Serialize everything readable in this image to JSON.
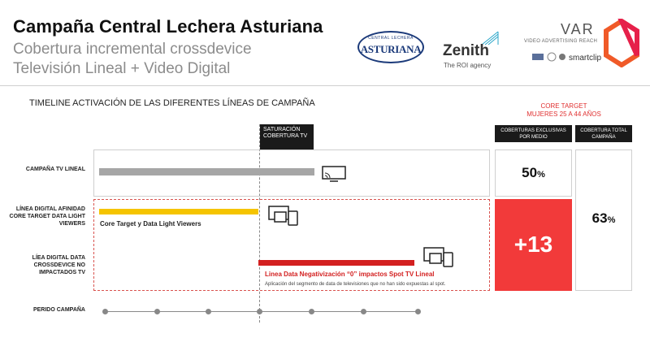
{
  "header": {
    "title": "Campaña Central Lechera Asturiana",
    "subtitle_line1": "Cobertura incremental crossdevice",
    "subtitle_line2": "Televisión Lineal + Video Digital"
  },
  "logos": {
    "asturiana_small": "CENTRAL LECHERA",
    "asturiana_big": "ASTURIANA",
    "zenith_name": "Zenith",
    "zenith_tagline": "The ROI agency",
    "var_name": "VAR",
    "var_tagline": "VIDEO ADVERTISING REACH",
    "var_partner": "smartclip"
  },
  "section": {
    "timeline_title": "TIMELINE ACTIVACIÓN DE LAS DIFERENTES  LÍNEAS DE CAMPAÑA",
    "core_target": "CORE TARGET",
    "core_target_desc": "MUJERES 25 A 44 AÑOS",
    "saturation_label": "SATURACIÓN COBERTURA TV",
    "col_exclusive": "COBERTURAS EXCLUSIVAS POR MEDIO",
    "col_total": "COBERTURA TOTAL CAMPAÑA"
  },
  "rows": {
    "tv_lineal": "CAMPAÑA TV LINEAL",
    "linea_digital": "LÍNEA DIGITAL AFINIDAD CORE TARGET DATA LIGHT VIEWERS",
    "lea_digital": "LÍEA DIGITAL DATA CROSSDEVICE NO IMPACTADOS TV",
    "periodo": "PERIDO CAMPAÑA"
  },
  "bars": {
    "core_label": "Core Target y Data Light Viewers",
    "neg_label": "Linea Data Negativización “0” impactos Spot TV Lineal",
    "neg_desc": "Aplicación del segmento de data de televisiones que no han sido expuestas al spot."
  },
  "results": {
    "tv_value": "50",
    "tv_unit": "%",
    "incremental": "+13",
    "total_value": "63",
    "total_unit": "%"
  },
  "colors": {
    "accent_red": "#f23a3a",
    "bar_red": "#d32020",
    "bar_yellow": "#f5c400",
    "bar_gray": "#a6a6a6"
  },
  "icons": [
    "tv-icon",
    "devices-icon",
    "devices-icon",
    "hexagon-logo-icon",
    "zenith-mark-icon"
  ]
}
